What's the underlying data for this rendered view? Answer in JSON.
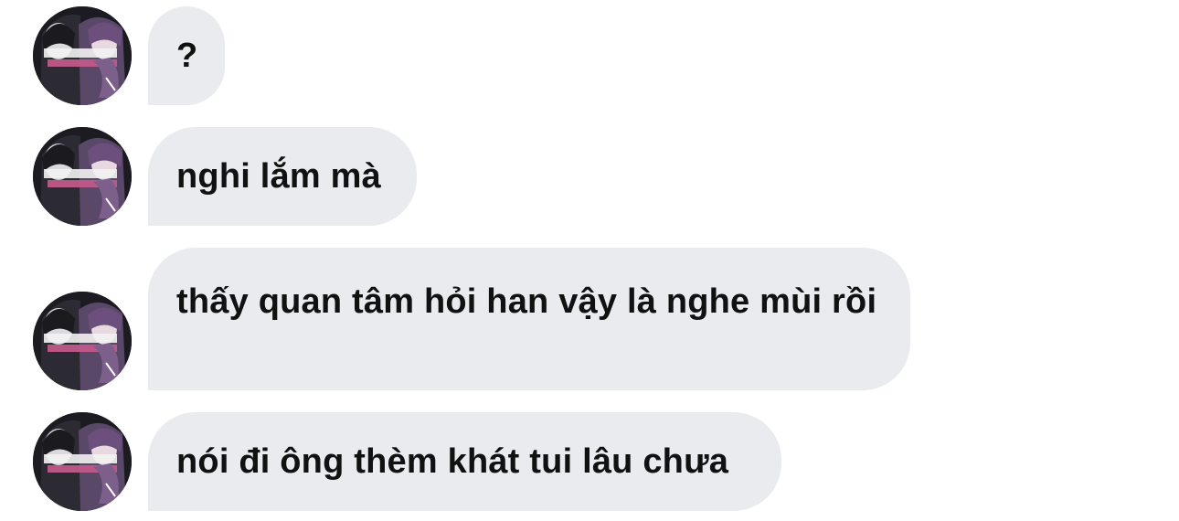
{
  "conversation": {
    "messages": [
      {
        "text": "?",
        "sender_avatar_icon": "anime-girl-avatar-icon"
      },
      {
        "text": "nghi lắm mà",
        "sender_avatar_icon": "anime-girl-avatar-icon"
      },
      {
        "text": "thấy quan tâm hỏi han vậy là nghe mùi rồi",
        "sender_avatar_icon": "anime-girl-avatar-icon"
      },
      {
        "text": "nói đi ông thèm khát tui lâu chưa",
        "sender_avatar_icon": "anime-girl-avatar-icon"
      }
    ],
    "colors": {
      "bubble_background": "#e9ebef",
      "text": "#111111",
      "page_background": "#ffffff"
    }
  }
}
